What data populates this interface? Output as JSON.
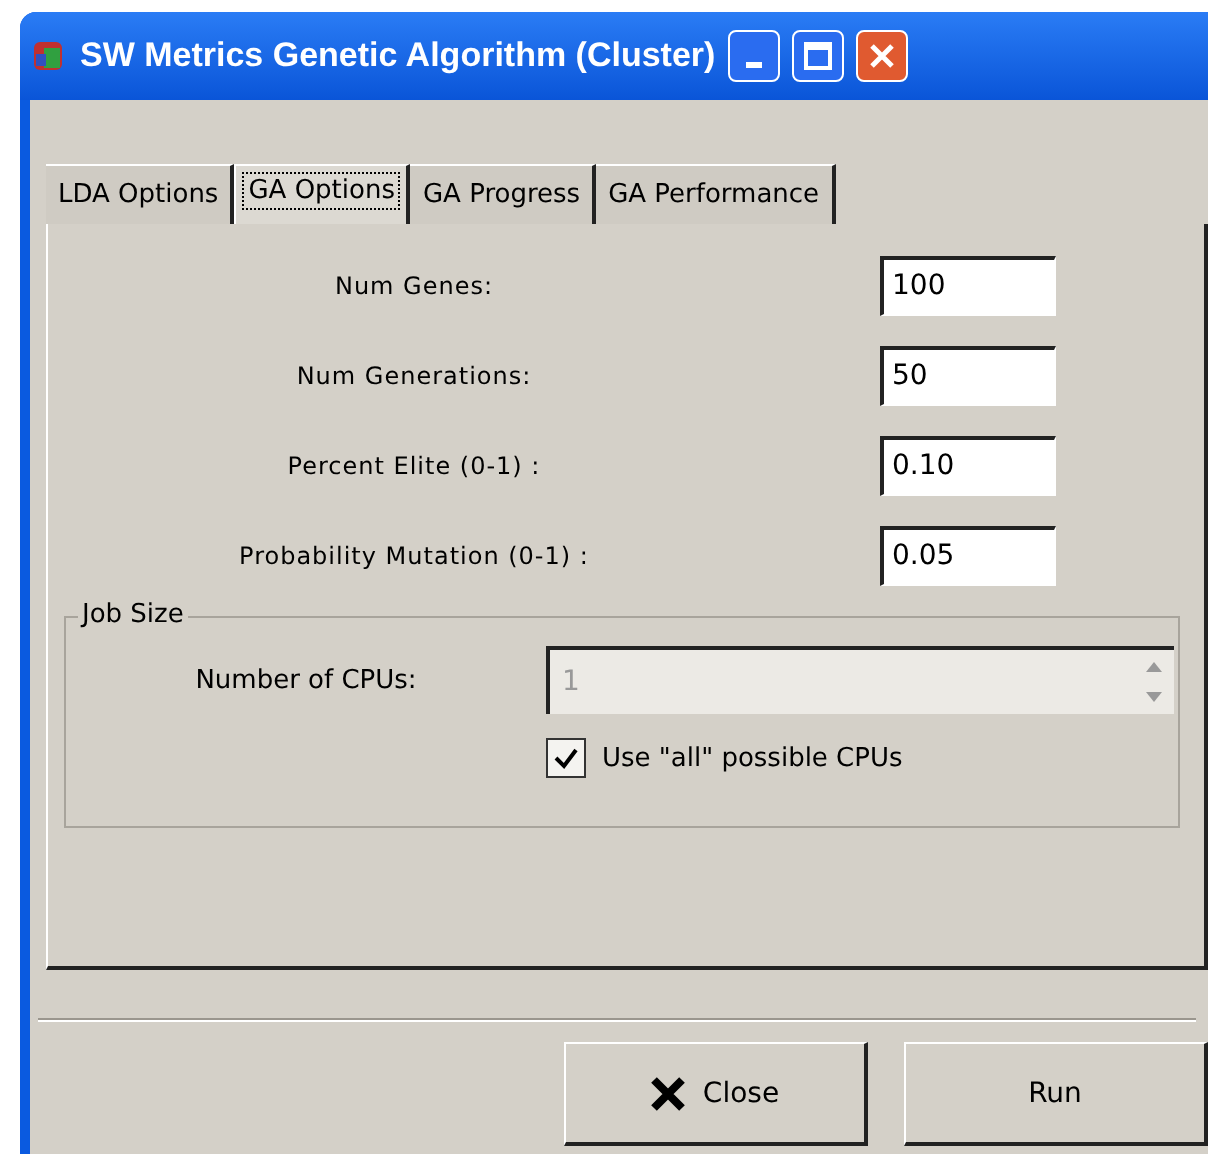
{
  "window": {
    "title": "SW Metrics Genetic Algorithm (Cluster)"
  },
  "tabs": [
    {
      "label": "LDA Options",
      "selected": false
    },
    {
      "label": "GA Options",
      "selected": true
    },
    {
      "label": "GA Progress",
      "selected": false
    },
    {
      "label": "GA Performance",
      "selected": false
    }
  ],
  "fields": [
    {
      "label": "Num Genes:",
      "value": "100"
    },
    {
      "label": "Num Generations:",
      "value": "50"
    },
    {
      "label": "Percent Elite (0-1) :",
      "value": "0.10"
    },
    {
      "label": "Probability Mutation (0-1) :",
      "value": "0.05"
    }
  ],
  "job_size": {
    "title": "Job Size",
    "cpus_label": "Number of CPUs:",
    "cpus_value": "1",
    "cpus_disabled": true,
    "use_all": {
      "label": "Use \"all\" possible CPUs",
      "checked": true
    }
  },
  "buttons": [
    {
      "kind": "close",
      "label": "Close"
    },
    {
      "kind": "run",
      "label": "Run"
    }
  ]
}
